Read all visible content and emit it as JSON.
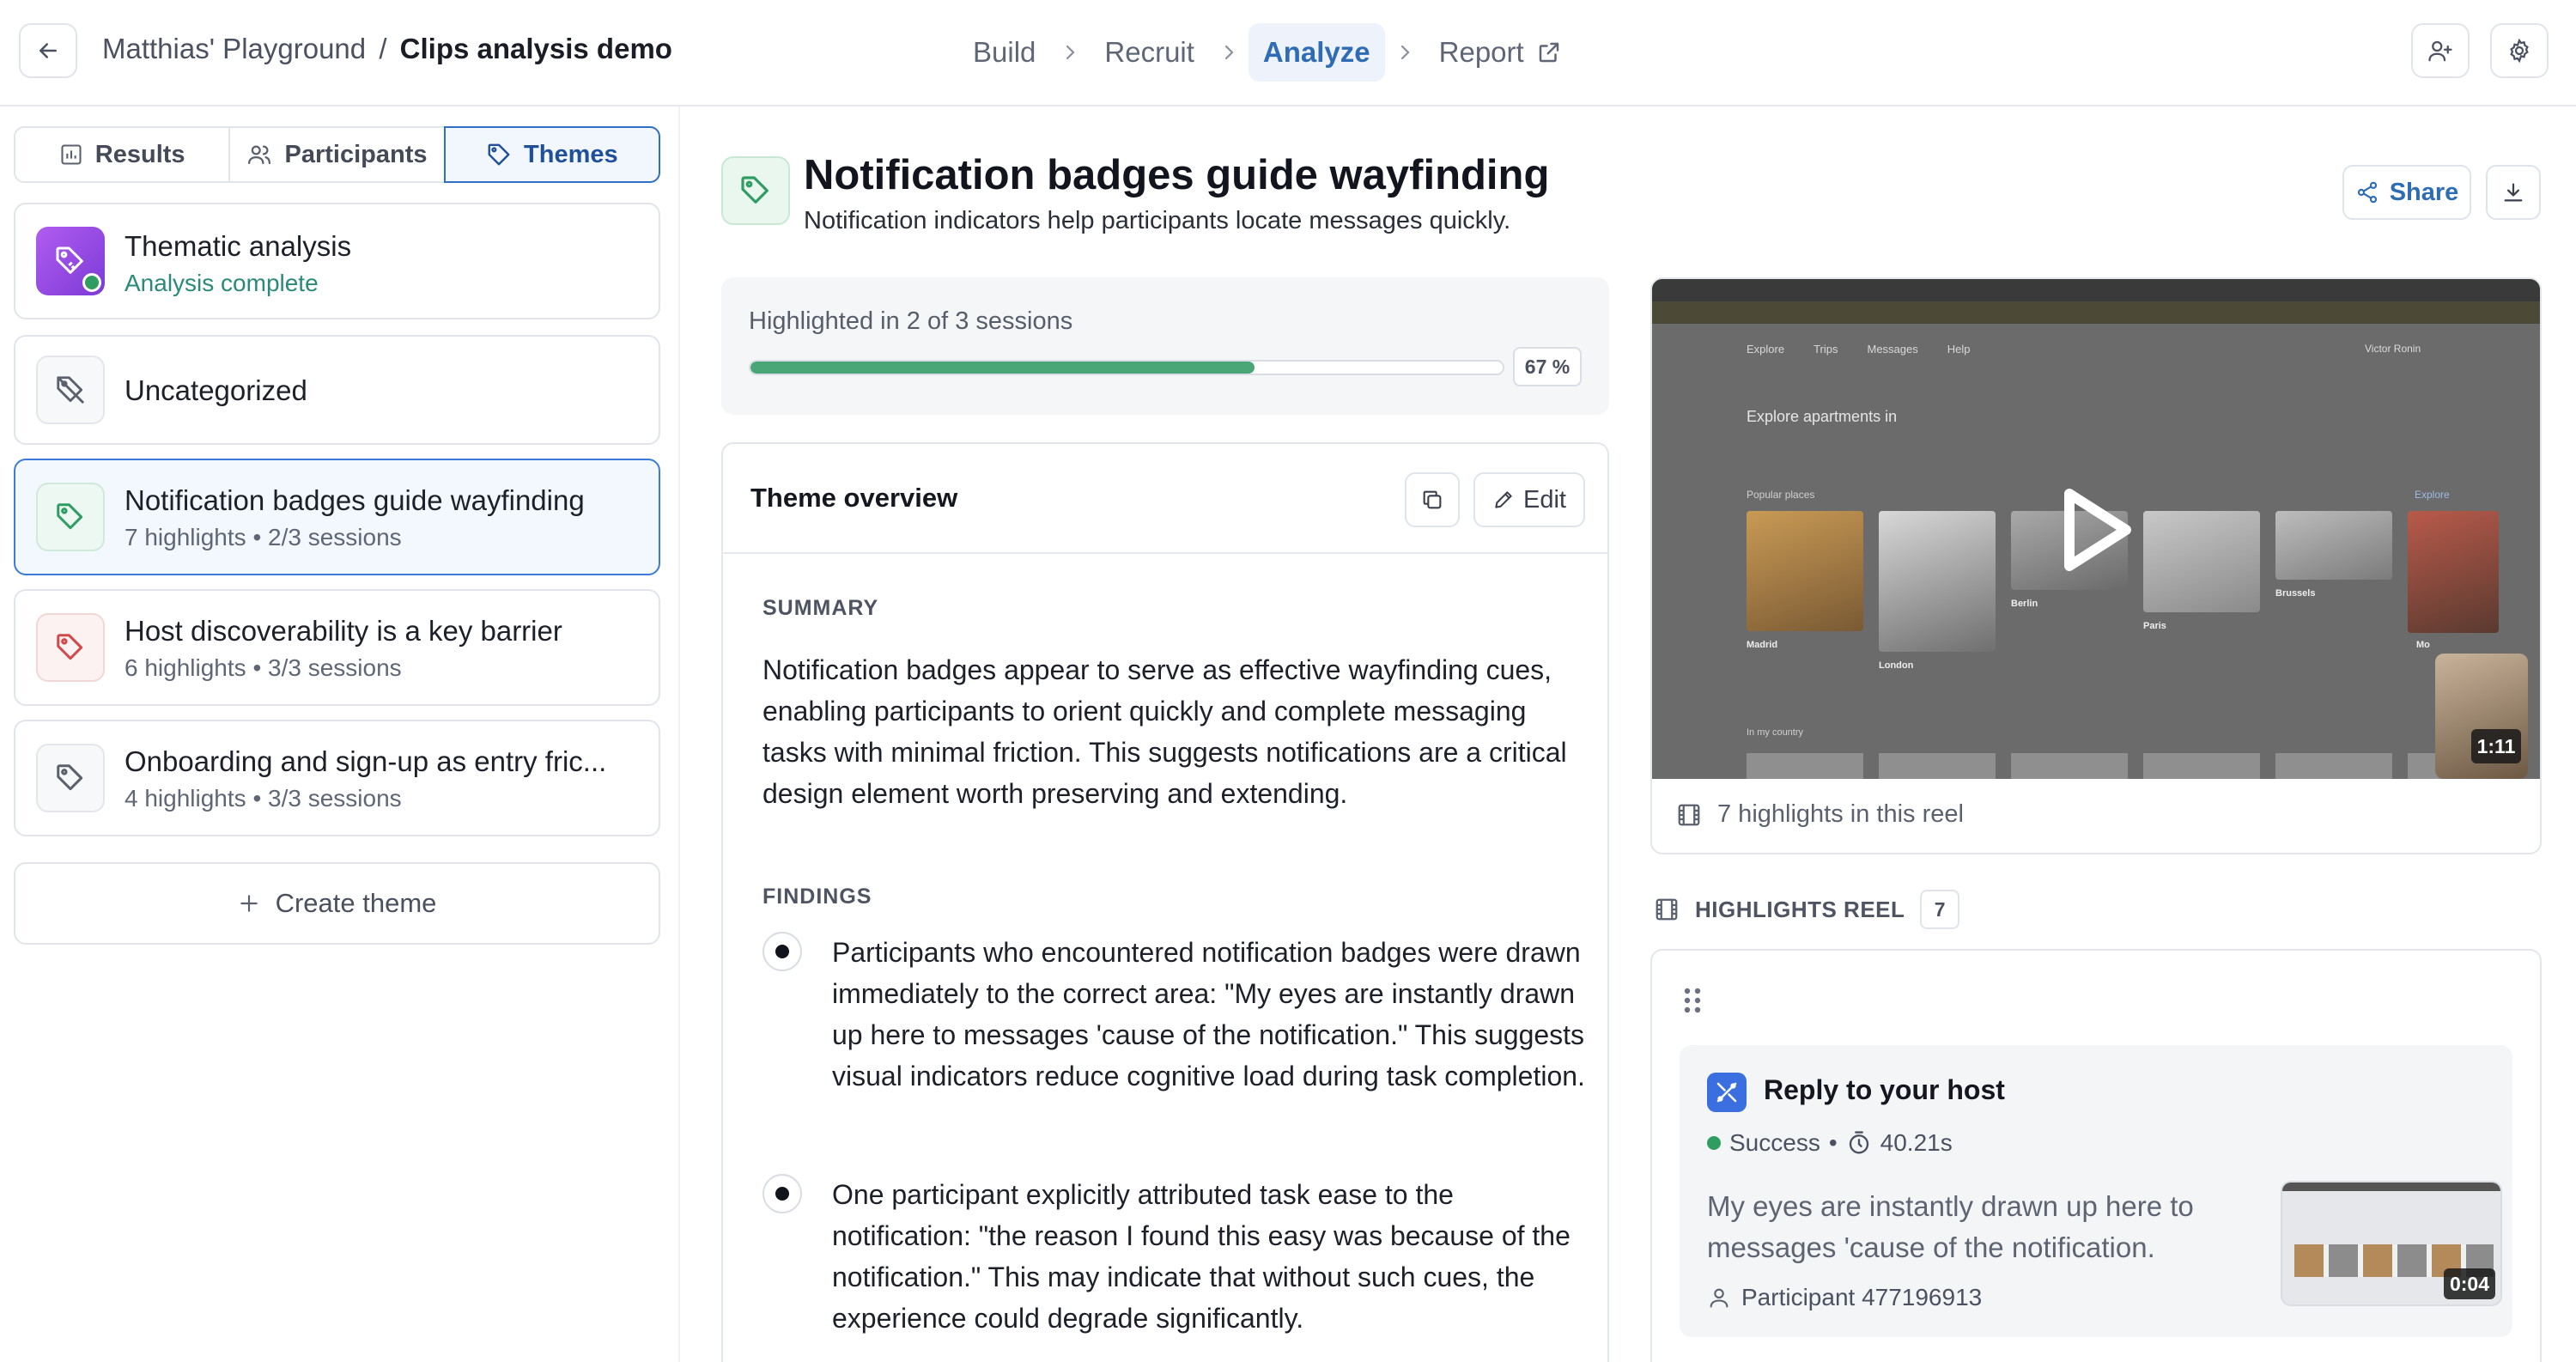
{
  "topbar": {
    "workspace": "Matthias' Playground",
    "separator": "/",
    "project": "Clips analysis demo",
    "steps": [
      {
        "label": "Build"
      },
      {
        "label": "Recruit"
      },
      {
        "label": "Analyze",
        "active": true
      },
      {
        "label": "Report"
      }
    ],
    "icons": [
      "arrow-left-icon",
      "chevron-right-icon",
      "external-link-icon",
      "user-plus-icon",
      "gear-icon"
    ]
  },
  "sidebar": {
    "tabs": [
      {
        "label": "Results",
        "icon": "bar-chart-icon"
      },
      {
        "label": "Participants",
        "icon": "users-icon"
      },
      {
        "label": "Themes",
        "icon": "tag-icon",
        "active": true
      }
    ],
    "thematic": {
      "title": "Thematic analysis",
      "status": "Analysis complete"
    },
    "uncategorized": {
      "title": "Uncategorized"
    },
    "themes": [
      {
        "title": "Notification badges guide wayfinding",
        "highlights": "7 highlights",
        "sessions": "2/3 sessions",
        "selected": true,
        "icon_color": "#2f9d62"
      },
      {
        "title": "Host discoverability is a key barrier",
        "highlights": "6 highlights",
        "sessions": "3/3 sessions",
        "icon_color": "#d04a4a"
      },
      {
        "title": "Onboarding and sign-up as entry fric...",
        "highlights": "4 highlights",
        "sessions": "3/3 sessions",
        "icon_color": "#5b606c"
      }
    ],
    "bullet_sep": "•",
    "create_label": "Create theme"
  },
  "theme": {
    "title": "Notification badges guide wayfinding",
    "subtitle": "Notification indicators help participants locate messages quickly.",
    "share_label": "Share",
    "progress": {
      "label": "Highlighted in 2 of 3 sessions",
      "fraction": 0.67,
      "percent_label": "67 %"
    },
    "overview": {
      "title": "Theme overview",
      "edit_label": "Edit",
      "summary_label": "SUMMARY",
      "summary": "Notification badges appear to serve as effective wayfinding cues, enabling participants to orient quickly and complete messaging tasks with minimal friction. This suggests notifications are a critical design element worth preserving and extending.",
      "findings_label": "FINDINGS",
      "findings": [
        "Participants who encountered notification badges were drawn immediately to the correct area: \"My eyes are instantly drawn up here to messages 'cause of the notification.\" This suggests visual indicators reduce cognitive load during task completion.",
        "One participant explicitly attributed task ease to the notification: \"the reason I found this easy was because of the notification.\" This may indicate that without such cues, the experience could degrade significantly."
      ]
    }
  },
  "video": {
    "duration": "1:11",
    "footer": "7 highlights in this reel",
    "screen": {
      "nav_tabs": [
        "Explore",
        "Trips",
        "Messages",
        "Help"
      ],
      "user": "Victor Ronin",
      "heading": "Explore apartments in",
      "popular": "Popular places",
      "explore_link": "Explore",
      "cities": [
        "Madrid",
        "London",
        "Berlin",
        "Paris",
        "Brussels",
        "Mo"
      ],
      "in_my_country": "In my country"
    }
  },
  "reel": {
    "label": "HIGHLIGHTS REEL",
    "count": "7",
    "clip": {
      "title": "Reply to your host",
      "status": "Success",
      "status_sep": "•",
      "time": "40.21s",
      "quote": "My eyes are instantly drawn up here to messages 'cause of the notification.",
      "participant": "Participant 477196913",
      "thumb_time": "0:04"
    }
  },
  "colors": {
    "accent": "#2e6db5",
    "progress_green": "#4aa677",
    "status_green": "#2f9d62"
  }
}
